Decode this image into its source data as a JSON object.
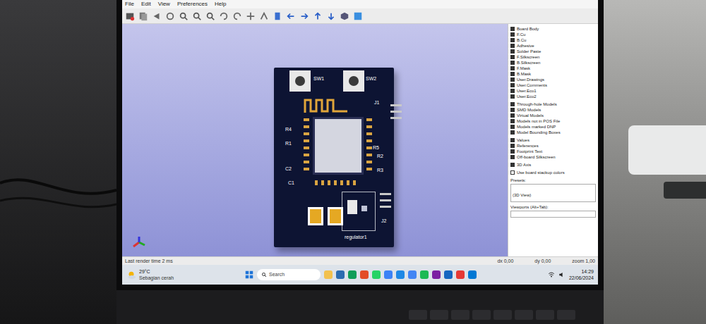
{
  "menu": [
    "File",
    "Edit",
    "View",
    "Preferences",
    "Help"
  ],
  "layer_groups": [
    [
      {
        "label": "Board Body",
        "checked": true
      },
      {
        "label": "F.Cu",
        "checked": true
      },
      {
        "label": "B.Cu",
        "checked": true
      },
      {
        "label": "Adhesive",
        "checked": true
      },
      {
        "label": "Solder Paste",
        "checked": true
      },
      {
        "label": "F.Silkscreen",
        "checked": true
      },
      {
        "label": "B.Silkscreen",
        "checked": true
      },
      {
        "label": "F.Mask",
        "checked": true
      },
      {
        "label": "B.Mask",
        "checked": true
      },
      {
        "label": "User.Drawings",
        "checked": true
      },
      {
        "label": "User.Comments",
        "checked": true
      },
      {
        "label": "User.Eco1",
        "checked": true
      },
      {
        "label": "User.Eco2",
        "checked": true
      }
    ],
    [
      {
        "label": "Through-hole Models",
        "checked": true
      },
      {
        "label": "SMD Models",
        "checked": true
      },
      {
        "label": "Virtual Models",
        "checked": true
      },
      {
        "label": "Models not in POS File",
        "checked": true
      },
      {
        "label": "Models marked DNP",
        "checked": true
      },
      {
        "label": "Model Bounding Boxes",
        "checked": true
      }
    ],
    [
      {
        "label": "Values",
        "checked": true
      },
      {
        "label": "References",
        "checked": true
      },
      {
        "label": "Footprint Text",
        "checked": true
      },
      {
        "label": "Off-board Silkscreen",
        "checked": true
      }
    ],
    [
      {
        "label": "3D Axis",
        "checked": true
      }
    ]
  ],
  "stackup": {
    "label": "Use board stackup colors",
    "checked": false
  },
  "preset": {
    "label": "Presets:",
    "value": "(3D View)"
  },
  "viewports": {
    "label": "Viewports (Alt+Tab):"
  },
  "board": {
    "labels": [
      "R4",
      "R1",
      "C2",
      "C1",
      "R5",
      "R2",
      "R3",
      "J1",
      "J2",
      "SW1",
      "SW2",
      "regulator1"
    ]
  },
  "status": {
    "render": "Last render time 2 ms",
    "fields": [
      "dx 0,00",
      "dy 0,00",
      "zoom 1,00"
    ]
  },
  "taskbar": {
    "temp": "29°C",
    "weather": "Sebagian cerah",
    "search": "Search",
    "time": "14:29",
    "date": "22/06/2024"
  }
}
